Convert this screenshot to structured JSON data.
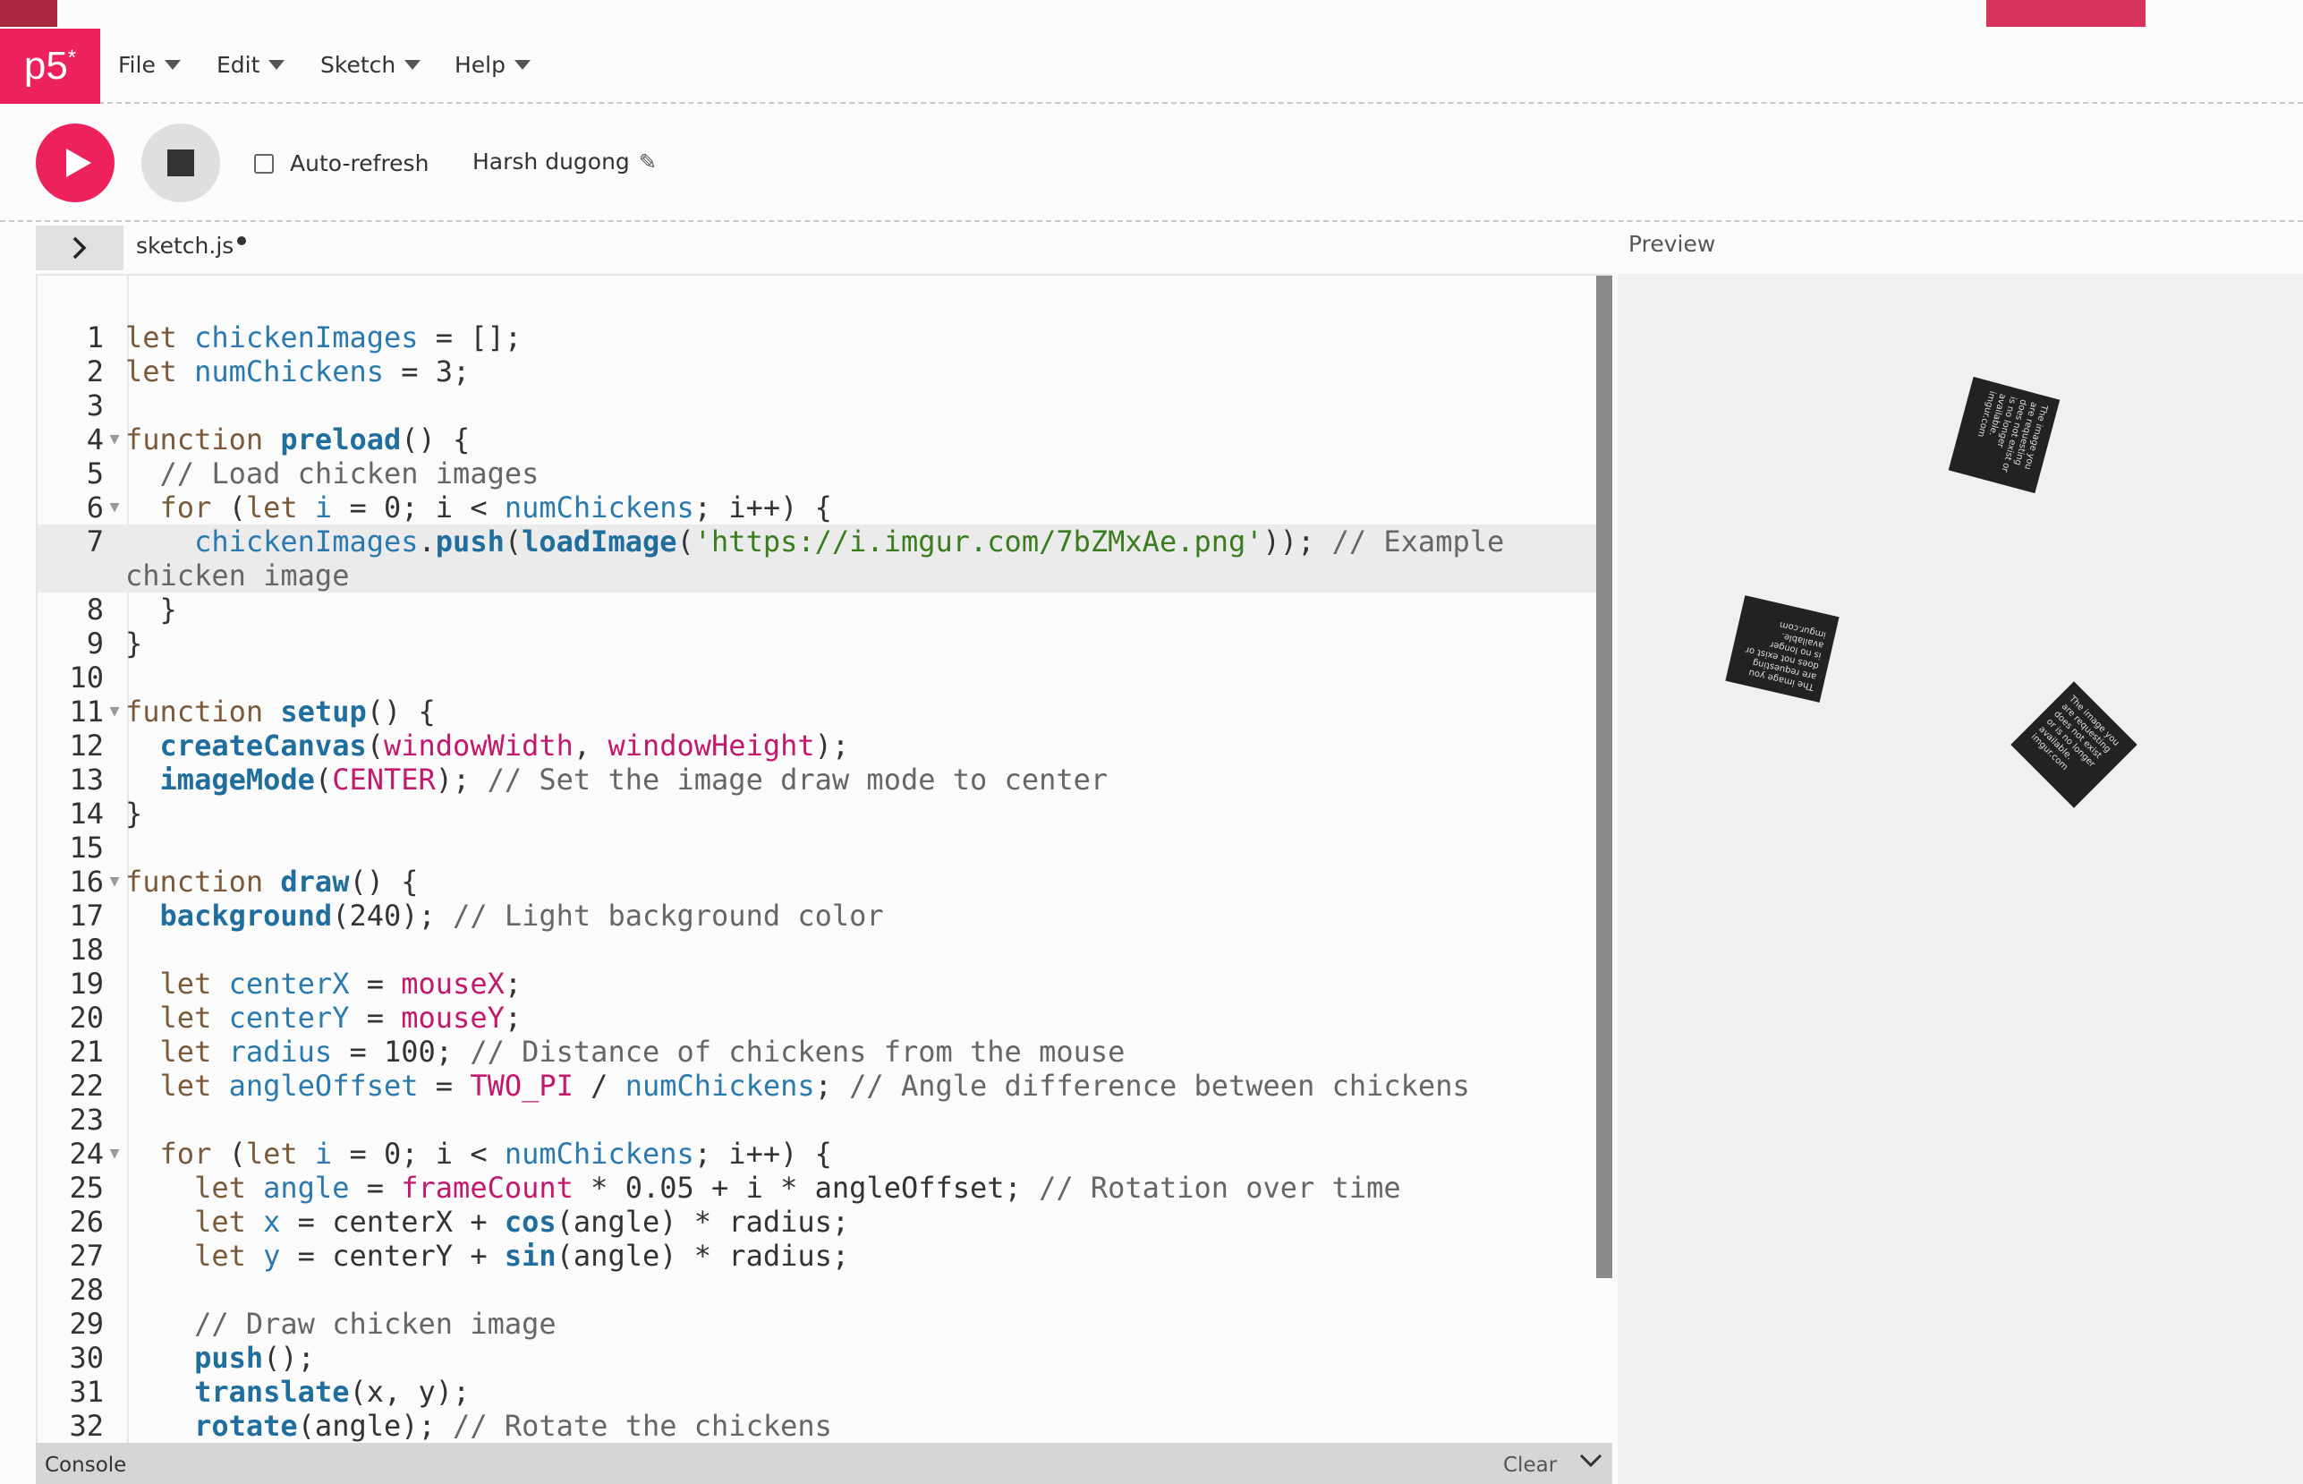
{
  "app": {
    "logo_text": "p5",
    "logo_star": "*"
  },
  "menu": [
    {
      "label": "File"
    },
    {
      "label": "Edit"
    },
    {
      "label": "Sketch"
    },
    {
      "label": "Help"
    }
  ],
  "toolbar": {
    "auto_refresh_label": "Auto-refresh",
    "auto_refresh_checked": false,
    "sketch_name": "Harsh dugong"
  },
  "tab": {
    "filename": "sketch.js",
    "unsaved": true
  },
  "preview": {
    "label": "Preview"
  },
  "console": {
    "title": "Console",
    "clear_label": "Clear"
  },
  "placeholder_image_text": "The image you are requesting does not exist or is no longer available. imgur.com",
  "colors": {
    "accent": "#ed225d",
    "stop": "#dfdfdf",
    "editor_bg": "#fbfbfb",
    "preview_bg": "#f0f0f0"
  },
  "icons": {
    "play": "play-icon",
    "stop": "stop-icon",
    "pencil": "pencil-icon",
    "expand": "chevron-right-icon",
    "fold": "fold-triangle-icon",
    "collapse": "chevron-down-icon"
  },
  "editor": {
    "lines": [
      {
        "n": "1",
        "tokens": [
          [
            "keyword",
            "let "
          ],
          [
            "var",
            "chickenImages"
          ],
          [
            "plain",
            " = [];"
          ]
        ]
      },
      {
        "n": "2",
        "tokens": [
          [
            "keyword",
            "let "
          ],
          [
            "var",
            "numChickens"
          ],
          [
            "plain",
            " = 3;"
          ]
        ]
      },
      {
        "n": "3",
        "tokens": []
      },
      {
        "n": "4",
        "fold": true,
        "tokens": [
          [
            "keyword",
            "function "
          ],
          [
            "fn",
            "preload"
          ],
          [
            "plain",
            "() {"
          ]
        ]
      },
      {
        "n": "5",
        "tokens": [
          [
            "comment",
            "  // Load chicken images"
          ]
        ]
      },
      {
        "n": "6",
        "fold": true,
        "tokens": [
          [
            "keyword",
            "  for "
          ],
          [
            "plain",
            "("
          ],
          [
            "keyword",
            "let "
          ],
          [
            "var",
            "i"
          ],
          [
            "plain",
            " = 0; i < "
          ],
          [
            "var",
            "numChickens"
          ],
          [
            "plain",
            "; i++) {"
          ]
        ]
      },
      {
        "n": "7",
        "tokens": [
          [
            "plain",
            "    "
          ],
          [
            "var",
            "chickenImages"
          ],
          [
            "plain",
            "."
          ],
          [
            "fn",
            "push"
          ],
          [
            "plain",
            "("
          ],
          [
            "fn",
            "loadImage"
          ],
          [
            "plain",
            "("
          ],
          [
            "string",
            "'https://i.imgur.com/7bZMxAe.png'"
          ],
          [
            "plain",
            "));"
          ],
          [
            "comment",
            " // Example chicken image"
          ]
        ]
      },
      {
        "n": "8",
        "tokens": [
          [
            "plain",
            "  }"
          ]
        ]
      },
      {
        "n": "9",
        "tokens": [
          [
            "plain",
            "}"
          ]
        ]
      },
      {
        "n": "10",
        "tokens": []
      },
      {
        "n": "11",
        "fold": true,
        "tokens": [
          [
            "keyword",
            "function "
          ],
          [
            "fn",
            "setup"
          ],
          [
            "plain",
            "() {"
          ]
        ]
      },
      {
        "n": "12",
        "tokens": [
          [
            "plain",
            "  "
          ],
          [
            "fn",
            "createCanvas"
          ],
          [
            "plain",
            "("
          ],
          [
            "const",
            "windowWidth"
          ],
          [
            "plain",
            ", "
          ],
          [
            "const",
            "windowHeight"
          ],
          [
            "plain",
            ");"
          ]
        ]
      },
      {
        "n": "13",
        "tokens": [
          [
            "plain",
            "  "
          ],
          [
            "fn",
            "imageMode"
          ],
          [
            "plain",
            "("
          ],
          [
            "const",
            "CENTER"
          ],
          [
            "plain",
            ");"
          ],
          [
            "comment",
            " // Set the image draw mode to center"
          ]
        ]
      },
      {
        "n": "14",
        "tokens": [
          [
            "plain",
            "}"
          ]
        ]
      },
      {
        "n": "15",
        "tokens": []
      },
      {
        "n": "16",
        "fold": true,
        "tokens": [
          [
            "keyword",
            "function "
          ],
          [
            "fn",
            "draw"
          ],
          [
            "plain",
            "() {"
          ]
        ]
      },
      {
        "n": "17",
        "tokens": [
          [
            "plain",
            "  "
          ],
          [
            "fn",
            "background"
          ],
          [
            "plain",
            "(240);"
          ],
          [
            "comment",
            " // Light background color"
          ]
        ]
      },
      {
        "n": "18",
        "tokens": []
      },
      {
        "n": "19",
        "tokens": [
          [
            "keyword",
            "  let "
          ],
          [
            "var",
            "centerX"
          ],
          [
            "plain",
            " = "
          ],
          [
            "const",
            "mouseX"
          ],
          [
            "plain",
            ";"
          ]
        ]
      },
      {
        "n": "20",
        "tokens": [
          [
            "keyword",
            "  let "
          ],
          [
            "var",
            "centerY"
          ],
          [
            "plain",
            " = "
          ],
          [
            "const",
            "mouseY"
          ],
          [
            "plain",
            ";"
          ]
        ]
      },
      {
        "n": "21",
        "tokens": [
          [
            "keyword",
            "  let "
          ],
          [
            "var",
            "radius"
          ],
          [
            "plain",
            " = 100;"
          ],
          [
            "comment",
            " // Distance of chickens from the mouse"
          ]
        ]
      },
      {
        "n": "22",
        "tokens": [
          [
            "keyword",
            "  let "
          ],
          [
            "var",
            "angleOffset"
          ],
          [
            "plain",
            " = "
          ],
          [
            "const",
            "TWO_PI"
          ],
          [
            "plain",
            " / "
          ],
          [
            "var",
            "numChickens"
          ],
          [
            "plain",
            ";"
          ],
          [
            "comment",
            " // Angle difference between chickens"
          ]
        ]
      },
      {
        "n": "23",
        "tokens": []
      },
      {
        "n": "24",
        "fold": true,
        "tokens": [
          [
            "keyword",
            "  for "
          ],
          [
            "plain",
            "("
          ],
          [
            "keyword",
            "let "
          ],
          [
            "var",
            "i"
          ],
          [
            "plain",
            " = 0; i < "
          ],
          [
            "var",
            "numChickens"
          ],
          [
            "plain",
            "; i++) {"
          ]
        ]
      },
      {
        "n": "25",
        "tokens": [
          [
            "keyword",
            "    let "
          ],
          [
            "var",
            "angle"
          ],
          [
            "plain",
            " = "
          ],
          [
            "const",
            "frameCount"
          ],
          [
            "plain",
            " * 0.05 + i * angleOffset;"
          ],
          [
            "comment",
            " // Rotation over time"
          ]
        ]
      },
      {
        "n": "26",
        "tokens": [
          [
            "keyword",
            "    let "
          ],
          [
            "var",
            "x"
          ],
          [
            "plain",
            " = centerX + "
          ],
          [
            "fn",
            "cos"
          ],
          [
            "plain",
            "(angle) * radius;"
          ]
        ]
      },
      {
        "n": "27",
        "tokens": [
          [
            "keyword",
            "    let "
          ],
          [
            "var",
            "y"
          ],
          [
            "plain",
            " = centerY + "
          ],
          [
            "fn",
            "sin"
          ],
          [
            "plain",
            "(angle) * radius;"
          ]
        ]
      },
      {
        "n": "28",
        "tokens": []
      },
      {
        "n": "29",
        "tokens": [
          [
            "comment",
            "    // Draw chicken image"
          ]
        ]
      },
      {
        "n": "30",
        "tokens": [
          [
            "plain",
            "    "
          ],
          [
            "fn",
            "push"
          ],
          [
            "plain",
            "();"
          ]
        ]
      },
      {
        "n": "31",
        "tokens": [
          [
            "plain",
            "    "
          ],
          [
            "fn",
            "translate"
          ],
          [
            "plain",
            "(x, y);"
          ]
        ]
      },
      {
        "n": "32",
        "tokens": [
          [
            "plain",
            "    "
          ],
          [
            "fn",
            "rotate"
          ],
          [
            "plain",
            "(angle);"
          ],
          [
            "comment",
            " // Rotate the chickens"
          ]
        ]
      }
    ]
  }
}
